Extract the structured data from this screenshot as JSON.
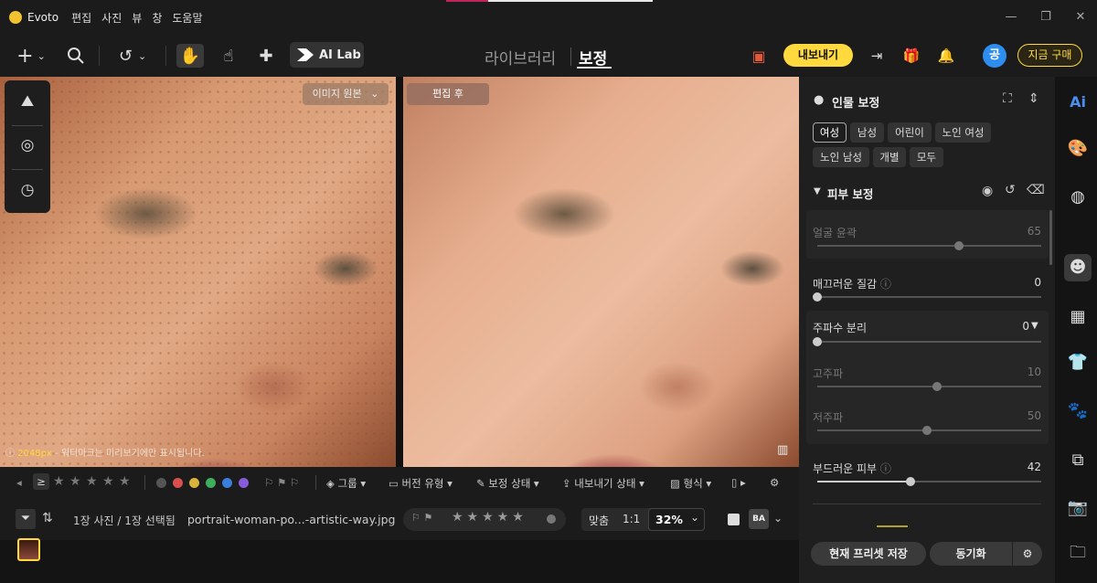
{
  "app": {
    "name": "Evoto",
    "menu": [
      "편집",
      "사진",
      "뷰",
      "창",
      "도움말"
    ]
  },
  "toolbar": {
    "ailab_label": "AI Lab",
    "nav": {
      "library": "라이브러리",
      "edit": "보정"
    },
    "export_label": "내보내기",
    "avatar_initial": "공",
    "buy_label": "지금 구매"
  },
  "viewer": {
    "left_tag": "이미지 원본",
    "right_tag": "편집 후",
    "watermark_size": "2048px",
    "watermark_text": "- 워터마크는 미리보기에만 표시됩니다."
  },
  "filterbar": {
    "group_label": "그룹",
    "version_label": "버전 유형",
    "edit_status_label": "보정 상태",
    "export_status_label": "내보내기 상태",
    "format_label": "형식",
    "label_colors": [
      "#555555",
      "#d94f4f",
      "#d9b43a",
      "#3fae5a",
      "#3a7fd9",
      "#8a5bd9"
    ]
  },
  "statusbar": {
    "selection": "1장 사진 / 1장 선택됨",
    "filename": "portrait-woman-po...-artistic-way.jpg",
    "fit_label": "맞춤",
    "ratio_label": "1:1",
    "zoom": "32%",
    "ba_label": "BA"
  },
  "panel": {
    "title": "인물 보정",
    "chips": [
      "여성",
      "남성",
      "어린이",
      "노인 여성",
      "노인 남성",
      "개별",
      "모두"
    ],
    "active_chip": "여성",
    "section": "피부 보정",
    "sliders": [
      {
        "label": "얼굴 윤곽",
        "value": "65"
      },
      {
        "label": "매끄러운 질감",
        "value": "0"
      },
      {
        "label": "주파수 분리",
        "value": "0"
      },
      {
        "label": "고주파",
        "value": "10"
      },
      {
        "label": "저주파",
        "value": "50"
      },
      {
        "label": "부드러운 피부",
        "value": "42"
      }
    ],
    "save_preset": "현재 프리셋 저장",
    "sync": "동기화"
  },
  "rail": {
    "ai_label": "Ai"
  }
}
